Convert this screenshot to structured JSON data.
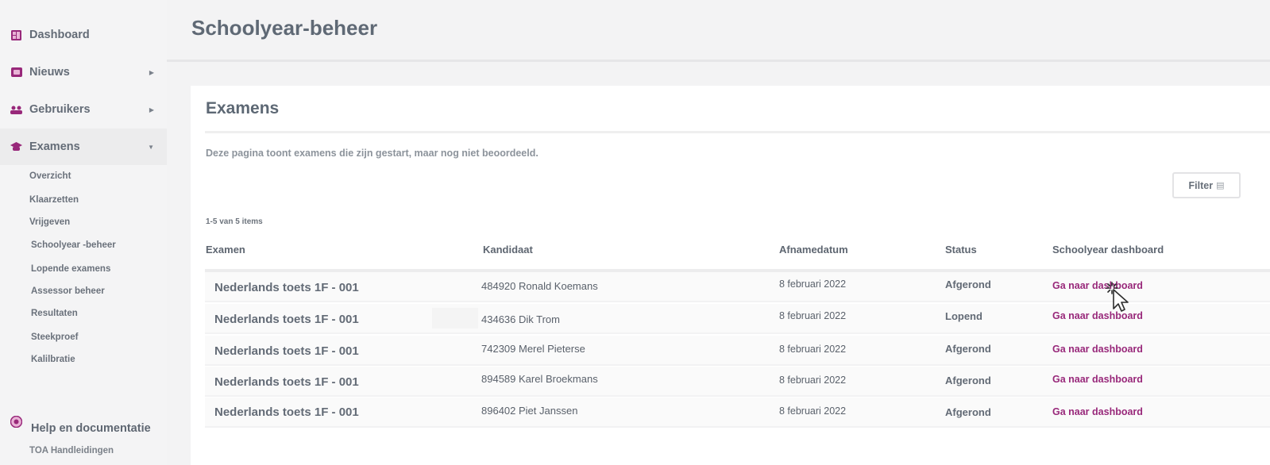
{
  "sidebar": {
    "items": [
      {
        "label": "Dashboard",
        "icon": "dashboard-icon"
      },
      {
        "label": "Nieuws",
        "icon": "news-icon"
      },
      {
        "label": "Gebruikers",
        "icon": "users-icon"
      },
      {
        "label": "Examens",
        "icon": "exam-icon"
      }
    ],
    "sub_items": [
      "Overzicht",
      "Klaarzetten",
      "Vrijgeven",
      "Schoolyear -beheer",
      "Lopende examens",
      "Assessor beheer",
      "Resultaten",
      "Steekproef",
      "Kalilbratie"
    ],
    "help": {
      "label": "Help en documentatie",
      "sub": "TOA Handleidingen"
    },
    "icon_color": "#98287a"
  },
  "header": {
    "title": "Schoolyear-beheer"
  },
  "card": {
    "title": "Examens",
    "description": "Deze pagina toont examens die zijn gestart, maar nog niet beoordeeld.",
    "filter_label": "Filter",
    "count": "1-5 van 5 items"
  },
  "table": {
    "headers": {
      "exam": "Examen",
      "candidate": "Kandidaat",
      "date": "Afnamedatum",
      "status": "Status",
      "dashboard": "Schoolyear dashboard"
    },
    "rows": [
      {
        "exam": "Nederlands toets 1F - 001",
        "candidate": "484920 Ronald Koemans",
        "date": "8 februari 2022",
        "status": "Afgerond",
        "link": "Ga naar dashboard"
      },
      {
        "exam": "Nederlands toets 1F - 001",
        "candidate": "434636 Dik Trom",
        "date": "8 februari 2022",
        "status": "Lopend",
        "link": "Ga naar dashboard"
      },
      {
        "exam": "Nederlands toets 1F - 001",
        "candidate": "742309 Merel Pieterse",
        "date": "8 februari 2022",
        "status": "Afgerond",
        "link": "Ga naar dashboard"
      },
      {
        "exam": "Nederlands toets 1F - 001",
        "candidate": "894589 Karel Broekmans",
        "date": "8 februari 2022",
        "status": "Afgerond",
        "link": "Ga naar dashboard"
      },
      {
        "exam": "Nederlands toets 1F - 001",
        "candidate": "896402 Piet Janssen",
        "date": "8 februari 2022",
        "status": "Afgerond",
        "link": "Ga naar dashboard"
      }
    ]
  },
  "accent_color": "#98287a"
}
